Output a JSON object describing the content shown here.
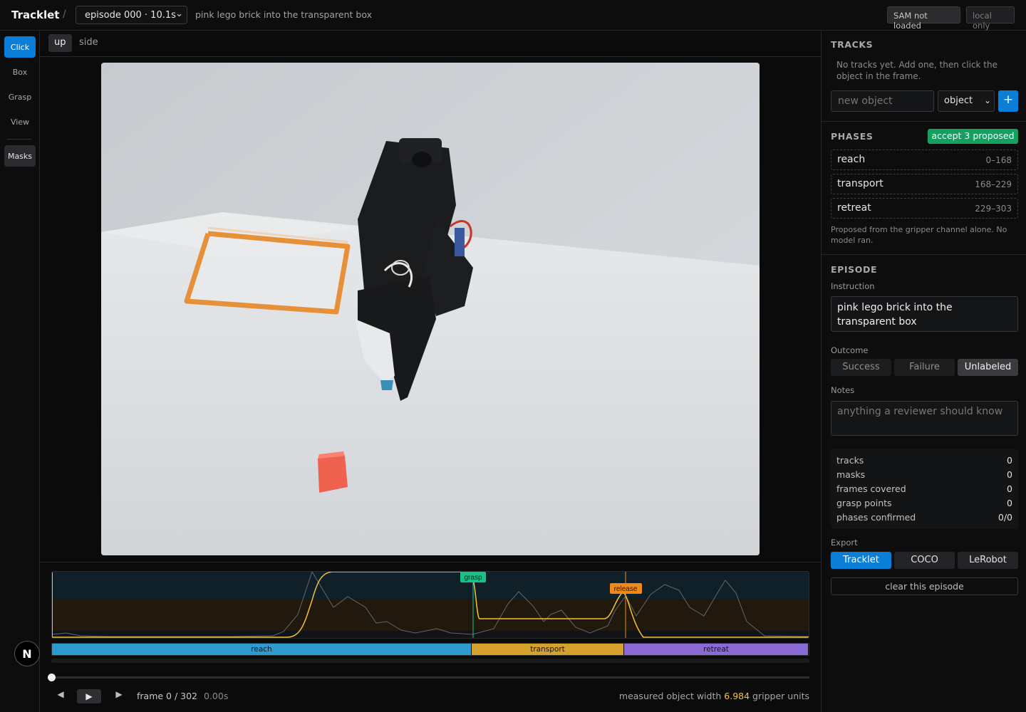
{
  "header": {
    "brand": "Tracklet",
    "separator": "/",
    "episode_select": "episode 000 · 10.1s",
    "instruction_title": "pink lego brick into the transparent box",
    "sam_badge": "SAM not loaded",
    "local_badge": "local only"
  },
  "tools": {
    "click": "Click",
    "box": "Box",
    "grasp": "Grasp",
    "view": "View",
    "masks": "Masks"
  },
  "logo_letter": "N",
  "view_tabs": {
    "up": "up",
    "side": "side",
    "active": "up"
  },
  "timeline": {
    "markers": {
      "grasp": "grasp",
      "release": "release"
    },
    "phases": [
      {
        "label": "reach",
        "start": 0,
        "end": 168,
        "color": "#2e9ad0"
      },
      {
        "label": "transport",
        "start": 168,
        "end": 229,
        "color": "#d4a22c"
      },
      {
        "label": "retreat",
        "start": 229,
        "end": 303,
        "color": "#8a6bd6"
      }
    ],
    "total_frames": 303,
    "current_frame": 0,
    "grasp_frame": 168,
    "release_frame": 229,
    "frame_label": "frame 0 / 302",
    "time_label": "0.00s",
    "width_prefix": "measured object width",
    "width_value": "6.984",
    "width_suffix": "gripper units",
    "prev_icon": "prev-frame-icon",
    "play_icon": "play-icon",
    "next_icon": "next-frame-icon"
  },
  "tracks": {
    "title": "TRACKS",
    "empty_text": "No tracks yet. Add one, then click the object in the frame.",
    "new_object_placeholder": "new object",
    "type_select": "object",
    "add_button": "+"
  },
  "phases_panel": {
    "title": "PHASES",
    "accept_button": "accept 3 proposed",
    "items": [
      {
        "name": "reach",
        "range": "0–168"
      },
      {
        "name": "transport",
        "range": "168–229"
      },
      {
        "name": "retreat",
        "range": "229–303"
      }
    ],
    "note": "Proposed from the gripper channel alone. No model ran."
  },
  "episode": {
    "title": "EPISODE",
    "instruction_label": "Instruction",
    "instruction_value": "pink lego brick into the transparent box",
    "outcome_label": "Outcome",
    "outcomes": [
      "Success",
      "Failure",
      "Unlabeled"
    ],
    "outcome_selected": "Unlabeled",
    "notes_label": "Notes",
    "notes_placeholder": "anything a reviewer should know",
    "stats": [
      {
        "key": "tracks",
        "value": "0"
      },
      {
        "key": "masks",
        "value": "0"
      },
      {
        "key": "frames covered",
        "value": "0"
      },
      {
        "key": "grasp points",
        "value": "0"
      },
      {
        "key": "phases confirmed",
        "value": "0/0"
      }
    ],
    "export_label": "Export",
    "export_options": [
      "Tracklet",
      "COCO",
      "LeRobot"
    ],
    "export_selected": "Tracklet",
    "clear_button": "clear this episode"
  },
  "colors": {
    "accent": "#0b7ed8",
    "accept": "#14a160",
    "gripper_line": "#f2c23a",
    "grasp_marker": "#19c08a",
    "release_marker": "#ef8a1a"
  }
}
